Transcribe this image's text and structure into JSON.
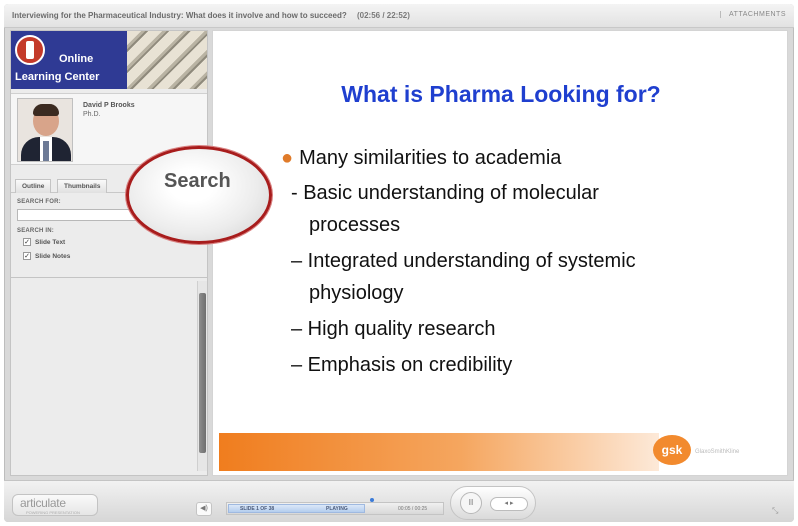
{
  "window": {
    "title": "Interviewing for the Pharmaceutical Industry: What does it involve and how to succeed?",
    "time": "(02:56 / 22:52)",
    "attachments_label": "ATTACHMENTS"
  },
  "sidebar": {
    "logo_line1": "Online",
    "logo_line2": "Learning Center",
    "presenter_name": "David P Brooks",
    "presenter_title": "Ph.D.",
    "tabs": [
      {
        "label": "Outline"
      },
      {
        "label": "Thumbnails"
      }
    ],
    "search_for_label": "SEARCH FOR:",
    "search_value": "",
    "search_in_label": "SEARCH IN:",
    "options": [
      {
        "label": "Slide Text",
        "checked": true
      },
      {
        "label": "Slide Notes",
        "checked": true
      }
    ]
  },
  "callout": {
    "label": "Search"
  },
  "slide": {
    "title": "What is Pharma Looking for?",
    "bullet": "Many similarities to academia",
    "sub_bullets": [
      "- Basic understanding of molecular",
      "processes",
      "– Integrated understanding of systemic",
      "physiology",
      "– High quality research",
      "– Emphasis on credibility"
    ],
    "logo_text": "gsk",
    "logo_caption": "GlaxoSmithKline"
  },
  "player": {
    "brand": "articulate",
    "brand_sub": "POWERING PRESENTATION",
    "slide_counter": "SLIDE 1 OF 38",
    "status": "PLAYING",
    "time": "00:05 / 00:25",
    "progress": 0.64,
    "pause_symbol": "II",
    "nav_symbols": "◂ ▸"
  },
  "icons": {
    "volume": "volume-icon",
    "pause": "pause-icon",
    "prev": "prev-icon",
    "next": "next-icon",
    "resize": "resize-icon"
  },
  "colors": {
    "title_blue": "#1f3fcf",
    "callout_ring": "#a81c1c",
    "orange": "#f07d1e",
    "logo_bg": "#2f3a94"
  }
}
